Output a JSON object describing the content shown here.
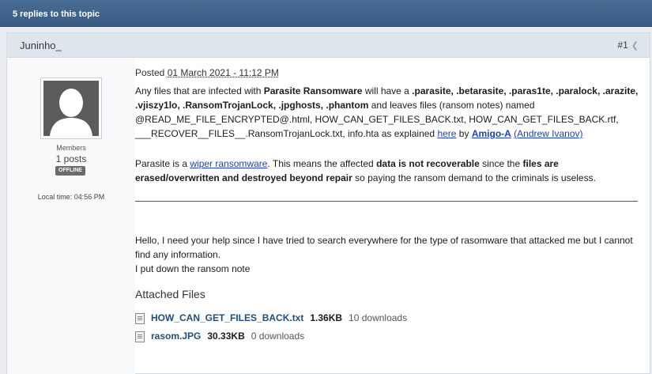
{
  "topic_header": {
    "replies_text": "5 replies to this topic"
  },
  "post": {
    "author": "Juninho_",
    "post_number": "#1",
    "sidebar": {
      "group": "Members",
      "posts": "1 posts",
      "status": "OFFLINE",
      "local_time": "Local time: 04:56 PM"
    },
    "posted_label": "Posted",
    "posted_date": "01 March 2021 - 11:12 PM",
    "quote": {
      "p1_a": "Any files that are infected with ",
      "p1_b": "Parasite Ransomware",
      "p1_c": " will have a ",
      "p1_d": ".parasite, .betarasite, .paras1te, .paralock, .arazite, .vjiszy1lo, .RansomTrojanLock, .jpghosts, .phantom",
      "p1_e": " and leaves files (ransom notes) named @READ_ME_FILE_ENCRYPTED@.html, HOW_CAN_GET_FILES_BACK.txt, HOW_CAN_GET_FILES_BACK.rtf, ___RECOVER__FILES__.RansomTrojanLock.txt, info.hta as explained ",
      "p1_link_here": "here",
      "p1_by": " by ",
      "p1_link_amigo": "Amigo-A",
      "p1_space": " ",
      "p1_link_andrew": "(Andrew Ivanov)",
      "p2_a": "Parasite is a ",
      "p2_link": "wiper ransomware",
      "p2_b": ". This means the affected ",
      "p2_c": "data is not recoverable",
      "p2_d": " since the ",
      "p2_e": "files are erased/overwritten and destroyed beyond repair",
      "p2_f": " so paying the ransom demand to the criminals is useless."
    },
    "message": {
      "line1": "Hello, I need your help since I have tried to search everywhere for the type of rasomware that attacked me but I cannot find any information.",
      "line2": "I put down the ransom note"
    },
    "attachments": {
      "title": "Attached Files",
      "files": [
        {
          "name": "HOW_CAN_GET_FILES_BACK.txt",
          "size": "1.36KB",
          "downloads": "10 downloads"
        },
        {
          "name": "rasom.JPG",
          "size": "30.33KB",
          "downloads": "0 downloads"
        }
      ]
    }
  }
}
